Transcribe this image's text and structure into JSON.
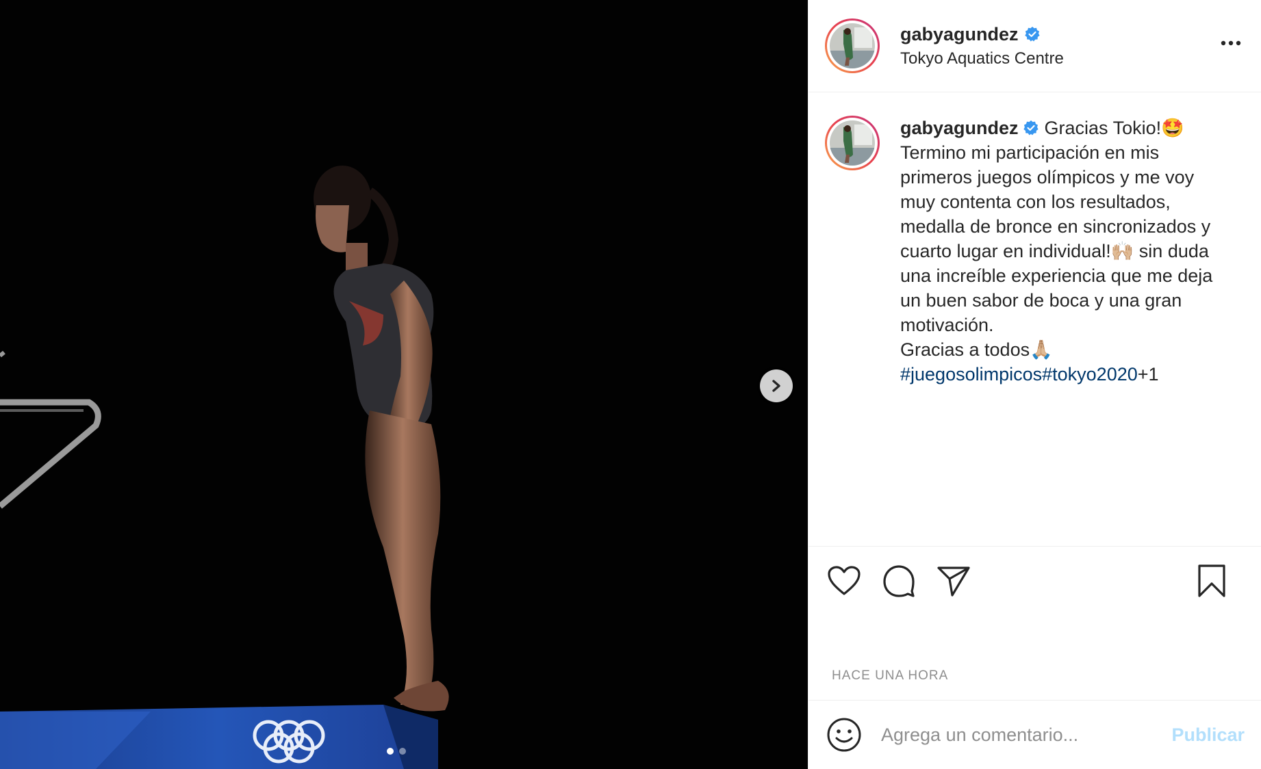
{
  "post": {
    "username": "gabyagundez",
    "location": "Tokyo Aquatics Centre",
    "verified_icon": "verified-badge-icon",
    "more_icon": "more-options-icon"
  },
  "caption": {
    "username": "gabyagundez",
    "lines": [
      "Gracias Tokio!🤩",
      "Termino mi participación en mis",
      "primeros juegos olímpicos y me voy",
      "muy contenta con los resultados,",
      "medalla de bronce en sincronizados y",
      "cuarto lugar en individual!🙌🏼 sin duda",
      "una increíble experiencia que me deja",
      "un buen sabor de boca y una gran",
      "motivación.",
      "Gracias a todos🙏🏼"
    ],
    "hashtags": [
      "#juegosolimpicos",
      "#tokyo2020"
    ],
    "extra": "+1"
  },
  "actions": {
    "like_icon": "heart-icon",
    "comment_icon": "comment-icon",
    "share_icon": "send-icon",
    "save_icon": "bookmark-icon"
  },
  "timestamp": "HACE UNA HORA",
  "comment": {
    "placeholder": "Agrega un comentario...",
    "publish_label": "Publicar",
    "emoji_icon": "smiley-icon"
  },
  "carousel": {
    "total": 2,
    "current": 1,
    "next_icon": "chevron-right-icon"
  },
  "colors": {
    "hashtag": "#00376b",
    "verified": "#3897f0",
    "publish_disabled": "#b2dffc",
    "text": "#262626",
    "muted": "#8e8e8e"
  }
}
